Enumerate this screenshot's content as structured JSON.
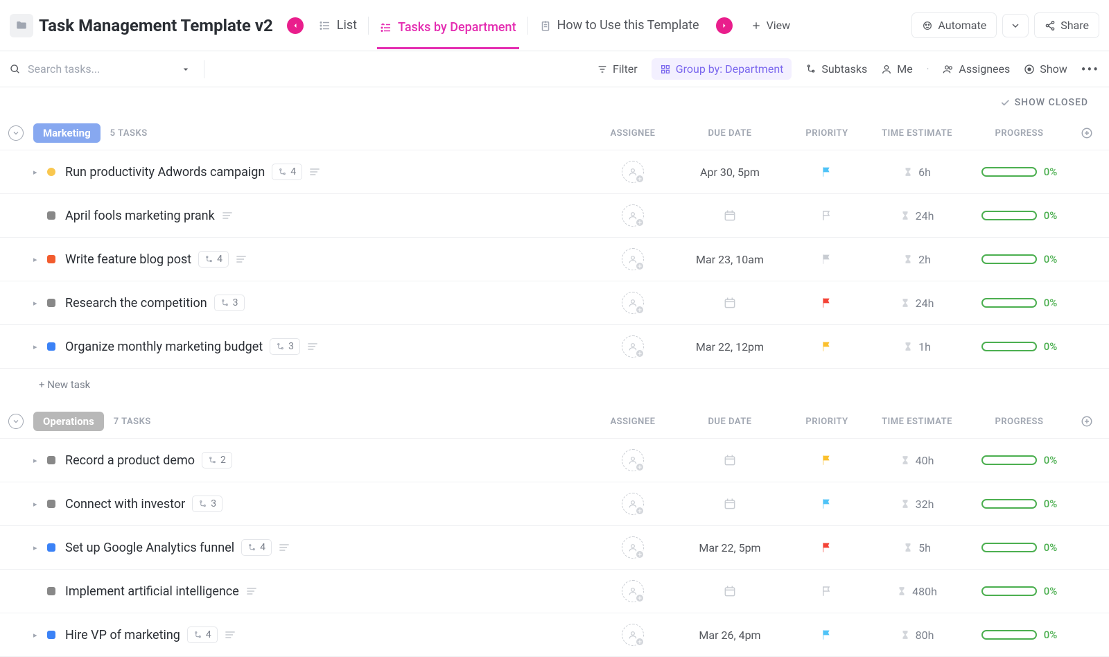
{
  "header": {
    "title": "Task Management Template v2",
    "views": [
      {
        "label": "List",
        "active": false
      },
      {
        "label": "Tasks by Department",
        "active": true
      },
      {
        "label": "How to Use this Template",
        "active": false
      }
    ],
    "add_view_label": "View",
    "automate_label": "Automate",
    "share_label": "Share"
  },
  "filters": {
    "search_placeholder": "Search tasks...",
    "filter_label": "Filter",
    "group_by_label": "Group by: Department",
    "subtasks_label": "Subtasks",
    "me_label": "Me",
    "assignees_label": "Assignees",
    "show_label": "Show"
  },
  "show_closed_label": "SHOW CLOSED",
  "columns": {
    "assignee": "ASSIGNEE",
    "due_date": "DUE DATE",
    "priority": "PRIORITY",
    "time_estimate": "TIME ESTIMATE",
    "progress": "PROGRESS"
  },
  "new_task_label": "+ New task",
  "groups": [
    {
      "name": "Marketing",
      "badge_class": "badge-marketing",
      "count_label": "5 TASKS",
      "tasks": [
        {
          "expand": true,
          "status_class": "sq-yellow",
          "name": "Run productivity Adwords campaign",
          "subtasks": "4",
          "has_desc": true,
          "due": "Apr 30, 5pm",
          "priority_color": "#4fc3f7",
          "priority_style": "solid",
          "time": "6h",
          "progress": "0%"
        },
        {
          "expand": false,
          "status_class": "sq-gray",
          "name": "April fools marketing prank",
          "subtasks": null,
          "has_desc": true,
          "due": null,
          "priority_color": "#c8ccd2",
          "priority_style": "outline",
          "time": "24h",
          "progress": "0%"
        },
        {
          "expand": true,
          "status_class": "sq-orange",
          "name": "Write feature blog post",
          "subtasks": "4",
          "has_desc": true,
          "due": "Mar 23, 10am",
          "priority_color": "#c8ccd2",
          "priority_style": "solid",
          "time": "2h",
          "progress": "0%"
        },
        {
          "expand": true,
          "status_class": "sq-gray",
          "name": "Research the competition",
          "subtasks": "3",
          "has_desc": false,
          "due": null,
          "priority_color": "#f44336",
          "priority_style": "solid",
          "time": "24h",
          "progress": "0%"
        },
        {
          "expand": true,
          "status_class": "sq-blue",
          "name": "Organize monthly marketing budget",
          "subtasks": "3",
          "has_desc": true,
          "due": "Mar 22, 12pm",
          "priority_color": "#fbc02d",
          "priority_style": "solid",
          "time": "1h",
          "progress": "0%"
        }
      ],
      "show_new_task": true
    },
    {
      "name": "Operations",
      "badge_class": "badge-operations",
      "count_label": "7 TASKS",
      "tasks": [
        {
          "expand": true,
          "status_class": "sq-gray",
          "name": "Record a product demo",
          "subtasks": "2",
          "has_desc": false,
          "due": null,
          "priority_color": "#fbc02d",
          "priority_style": "solid",
          "time": "40h",
          "progress": "0%"
        },
        {
          "expand": true,
          "status_class": "sq-gray",
          "name": "Connect with investor",
          "subtasks": "3",
          "has_desc": false,
          "due": null,
          "priority_color": "#4fc3f7",
          "priority_style": "solid",
          "time": "32h",
          "progress": "0%"
        },
        {
          "expand": true,
          "status_class": "sq-blue",
          "name": "Set up Google Analytics funnel",
          "subtasks": "4",
          "has_desc": true,
          "due": "Mar 22, 5pm",
          "priority_color": "#f44336",
          "priority_style": "solid",
          "time": "5h",
          "progress": "0%"
        },
        {
          "expand": false,
          "status_class": "sq-gray",
          "name": "Implement artificial intelligence",
          "subtasks": null,
          "has_desc": true,
          "due": null,
          "priority_color": "#c8ccd2",
          "priority_style": "outline",
          "time": "480h",
          "progress": "0%"
        },
        {
          "expand": true,
          "status_class": "sq-blue",
          "name": "Hire VP of marketing",
          "subtasks": "4",
          "has_desc": true,
          "due": "Mar 26, 4pm",
          "priority_color": "#4fc3f7",
          "priority_style": "solid",
          "time": "80h",
          "progress": "0%"
        }
      ],
      "show_new_task": false
    }
  ]
}
